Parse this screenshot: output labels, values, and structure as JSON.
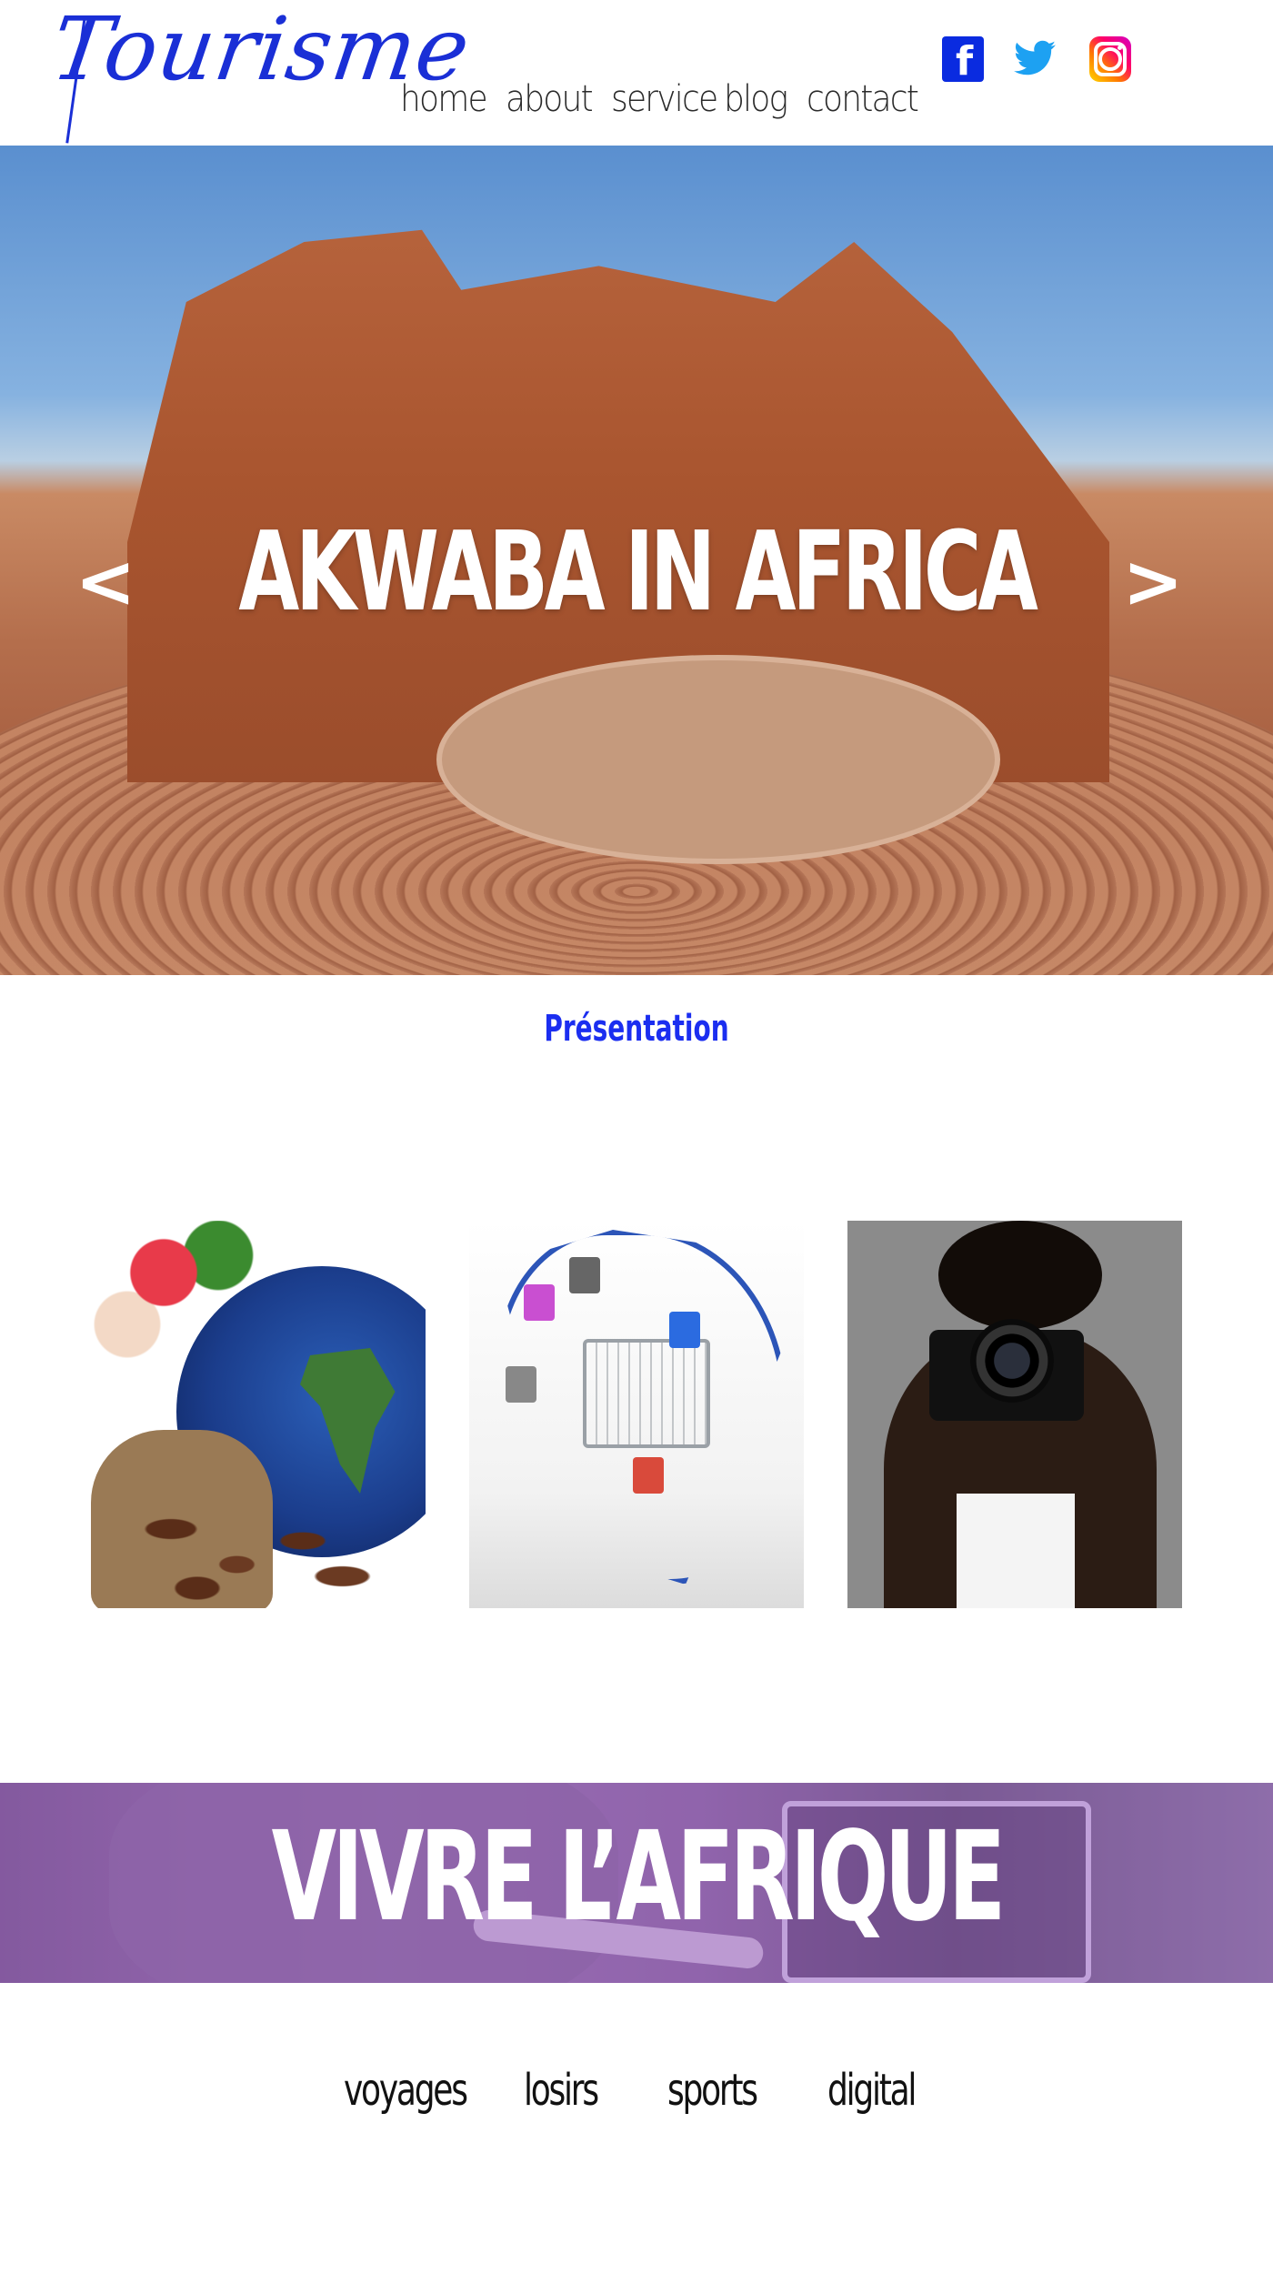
{
  "header": {
    "logo_text": "Tourisme",
    "nav": [
      "home",
      "about",
      "service",
      "blog",
      "contact"
    ],
    "social": [
      "facebook-icon",
      "twitter-icon",
      "instagram-icon"
    ],
    "colors": {
      "brand_blue": "#1a2fd6",
      "nav_text": "#2a2a2a",
      "facebook": "#0a2be0",
      "twitter": "#1da1f2"
    }
  },
  "hero": {
    "title": "AKWABA IN AFRICA",
    "prev_label": "<",
    "next_label": ">"
  },
  "presentation": {
    "title": "Présentation",
    "color": "#1b2ef0"
  },
  "cards": [
    {
      "image": "cocoa-globe-image"
    },
    {
      "image": "africa-shopping-image"
    },
    {
      "image": "photographer-image"
    }
  ],
  "banner": {
    "title": "VIVRE L’AFRIQUE"
  },
  "categories": [
    "voyages",
    "losirs",
    "sports",
    "digital"
  ]
}
